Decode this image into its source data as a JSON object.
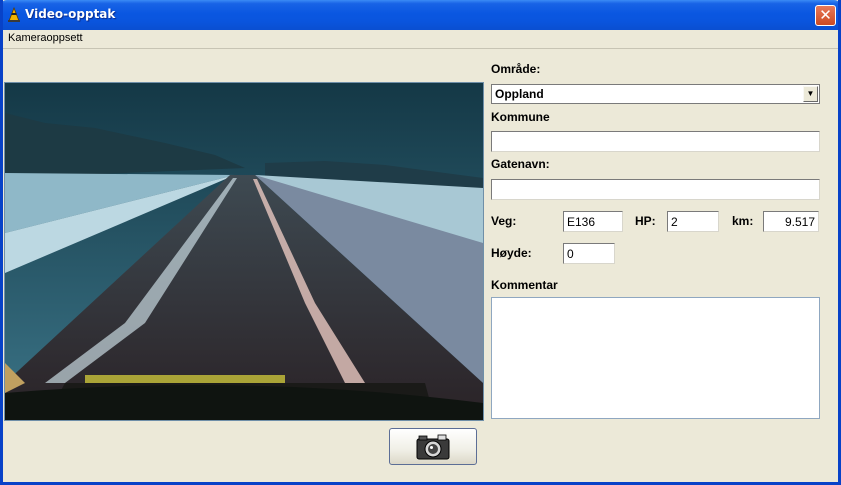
{
  "window": {
    "title": "Video-opptak",
    "close_glyph": "✕"
  },
  "menu": {
    "items": [
      "Kameraoppsett"
    ]
  },
  "form": {
    "omrade_label": "Område:",
    "omrade_value": "Oppland",
    "kommune_label": "Kommune",
    "kommune_value": "",
    "gatenavn_label": "Gatenavn:",
    "gatenavn_value": "",
    "veg_label": "Veg:",
    "veg_value": "E136",
    "hp_label": "HP:",
    "hp_value": "2",
    "km_label": "km:",
    "km_value": "9.517",
    "hoyde_label": "Høyde:",
    "hoyde_value": "0",
    "kommentar_label": "Kommentar",
    "kommentar_value": ""
  },
  "icons": {
    "app": "traffic-cone-icon",
    "camera": "camera-icon",
    "dropdown": "chevron-down-icon"
  },
  "colors": {
    "titlebar": "#0a57e1",
    "window_bg": "#ece9d8",
    "close": "#cc4a22"
  }
}
